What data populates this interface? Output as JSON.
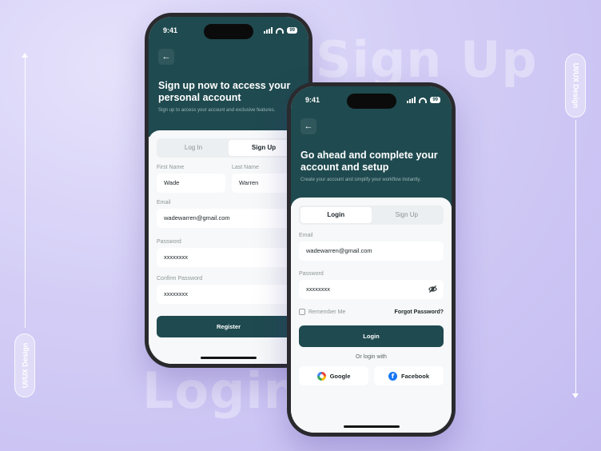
{
  "background": {
    "word_top": "Sign Up",
    "word_bottom": "Login",
    "tag_left": "UI/UX Design",
    "tag_right": "UI/UX Design"
  },
  "colors": {
    "primary": "#1f4a4f",
    "background": "#d3cdf6",
    "sheet": "#f6f8f9"
  },
  "signup_phone": {
    "time": "9:41",
    "battery": "99",
    "title": "Sign up now to access your personal account",
    "subtitle": "Sign up to access your account and exclusive features.",
    "tabs": [
      {
        "label": "Log In"
      },
      {
        "label": "Sign Up",
        "active": true
      }
    ],
    "first_name_label": "First Name",
    "first_name_value": "Wade",
    "last_name_label": "Last Name",
    "last_name_value": "Warren",
    "email_label": "Email",
    "email_value": "wadewarren@gmail.com",
    "password_label": "Password",
    "password_value": "xxxxxxxx",
    "confirm_label": "Confirm Password",
    "confirm_value": "xxxxxxxx",
    "register_button": "Register"
  },
  "login_phone": {
    "time": "9:41",
    "battery": "99",
    "title": "Go ahead and complete your account and setup",
    "subtitle": "Create your account and simplify your workflow instantly.",
    "tabs": [
      {
        "label": "Login",
        "active": true
      },
      {
        "label": "Sign Up"
      }
    ],
    "email_label": "Email",
    "email_value": "wadewarren@gmail.com",
    "password_label": "Password",
    "password_value": "xxxxxxxx",
    "remember_label": "Remember Me",
    "forgot_label": "Forgot Password?",
    "login_button": "Login",
    "or_text": "Or login with",
    "google_label": "Google",
    "facebook_label": "Facebook"
  }
}
